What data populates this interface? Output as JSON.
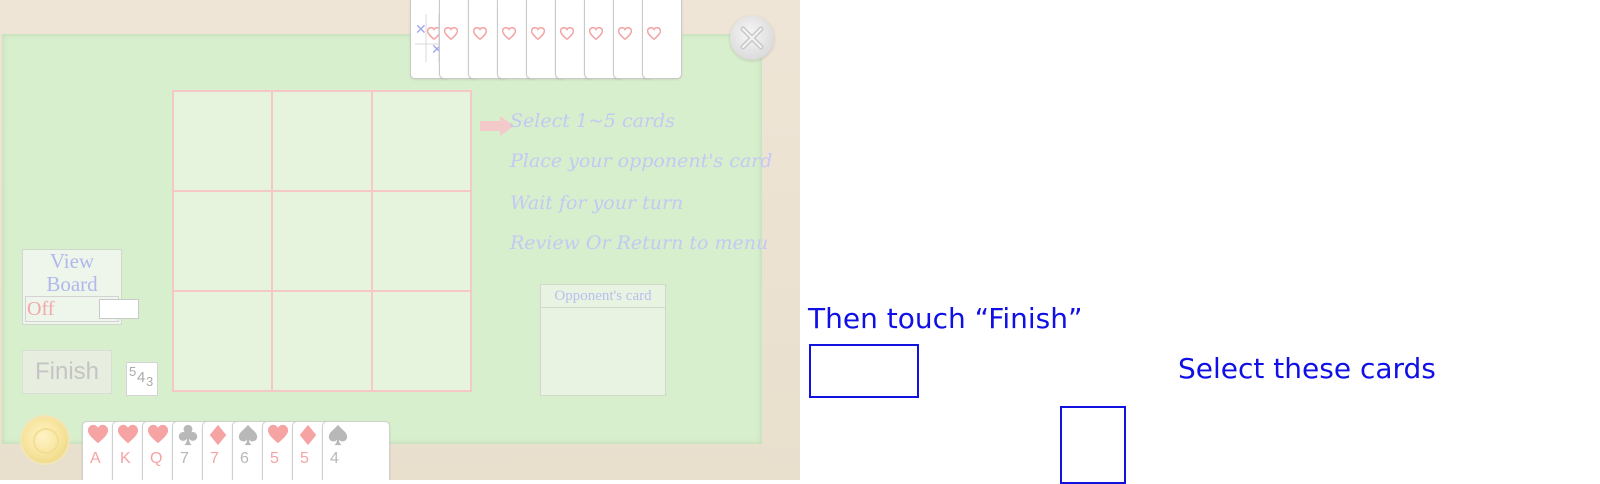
{
  "colors": {
    "felt": "#d8efcd",
    "board_lines": "#f6c7c7",
    "step_text": "#c3c8f4",
    "annotation": "#1010e6",
    "red_suit": "#f5a3a3",
    "black_suit": "#b8b8b8"
  },
  "history_cards": [
    {
      "marks": [
        "x",
        "heart",
        "heart",
        "empty",
        "x",
        "empty"
      ]
    },
    {
      "marks": [
        "heart"
      ]
    },
    {
      "marks": [
        "heart"
      ]
    },
    {
      "marks": [
        "heart"
      ]
    },
    {
      "marks": [
        "heart"
      ]
    },
    {
      "marks": [
        "heart"
      ]
    },
    {
      "marks": [
        "heart"
      ]
    },
    {
      "marks": [
        "heart"
      ]
    },
    {
      "marks": [
        "heart"
      ]
    }
  ],
  "close_icon": "close-icon",
  "steps": {
    "step1": "Select 1~5 cards",
    "step2": "Place your opponent's card",
    "step3": "Wait for your turn",
    "step4": "Review Or Return to menu",
    "active_index": 1
  },
  "view_board": {
    "title_line1": "View",
    "title_line2": "Board",
    "state": "Off"
  },
  "finish_label": "Finish",
  "counter": {
    "d1": "5",
    "d2": "4",
    "d3": "3"
  },
  "opponent_card_label": "Opponent's card",
  "hand": [
    {
      "suit": "heart",
      "rank": "A"
    },
    {
      "suit": "heart",
      "rank": "K"
    },
    {
      "suit": "heart",
      "rank": "Q"
    },
    {
      "suit": "club",
      "rank": "7"
    },
    {
      "suit": "diamond",
      "rank": "7"
    },
    {
      "suit": "spade",
      "rank": "6"
    },
    {
      "suit": "heart",
      "rank": "5"
    },
    {
      "suit": "diamond",
      "rank": "5"
    },
    {
      "suit": "spade",
      "rank": "4"
    }
  ],
  "tutorial": {
    "finish_hint": "Then touch “Finish”",
    "select_hint": "Select these cards"
  }
}
